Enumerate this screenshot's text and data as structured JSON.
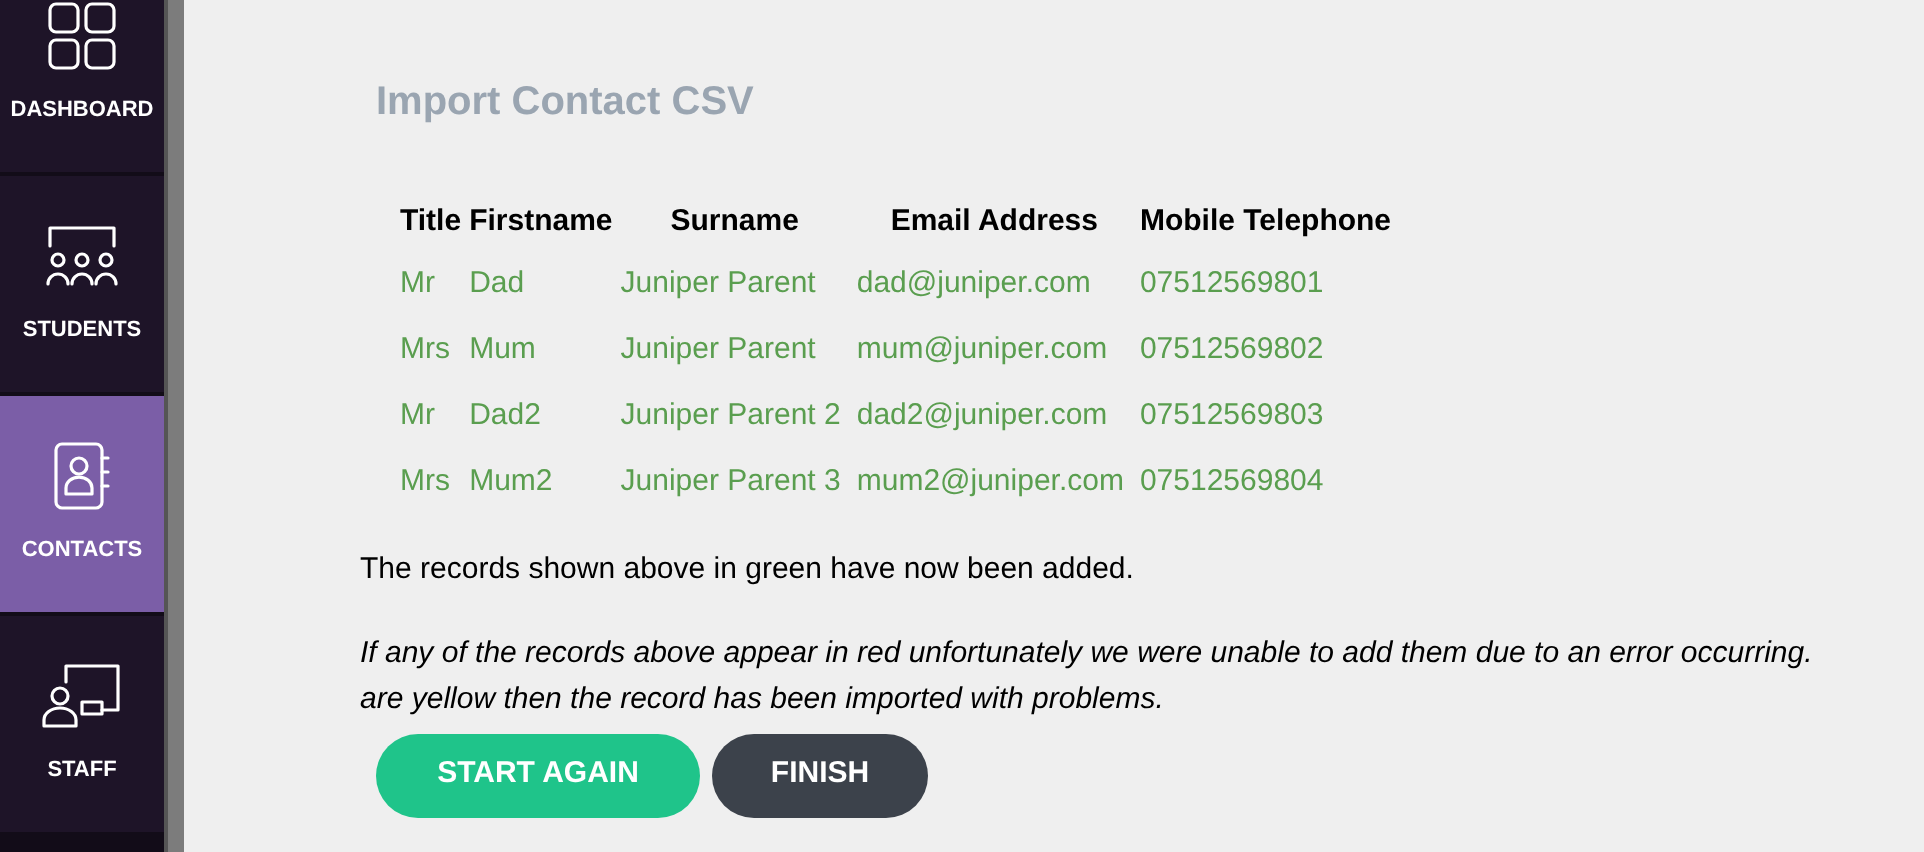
{
  "sidebar": {
    "items": [
      {
        "label": "DASHBOARD",
        "kind": "grid",
        "selected": false
      },
      {
        "label": "STUDENTS",
        "kind": "students",
        "selected": false
      },
      {
        "label": "CONTACTS",
        "kind": "contacts",
        "selected": true
      },
      {
        "label": "STAFF",
        "kind": "staff",
        "selected": false
      }
    ]
  },
  "page_title": "Import Contact CSV",
  "table": {
    "columns": [
      "Title",
      "Firstname",
      "Surname",
      "Email Address",
      "Mobile Telephone"
    ],
    "rows": [
      {
        "color": "#5a9e4f",
        "cells": [
          "Mr",
          "Dad",
          "Juniper Parent",
          "dad@juniper.com",
          "07512569801"
        ]
      },
      {
        "color": "#5a9e4f",
        "cells": [
          "Mrs",
          "Mum",
          "Juniper Parent",
          "mum@juniper.com",
          "07512569802"
        ]
      },
      {
        "color": "#5a9e4f",
        "cells": [
          "Mr",
          "Dad2",
          "Juniper Parent 2",
          "dad2@juniper.com",
          "07512569803"
        ]
      },
      {
        "color": "#5a9e4f",
        "cells": [
          "Mrs",
          "Mum2",
          "Juniper Parent 3",
          "mum2@juniper.com",
          "07512569804"
        ]
      }
    ]
  },
  "message": "The records shown above in green have now been added.",
  "note_lines": [
    "If any of the records above appear in red unfortunately we were unable to add them due to an error occurring.",
    "are yellow then the record has been imported with problems."
  ],
  "buttons": [
    {
      "label": "START AGAIN",
      "kind": "primary"
    },
    {
      "label": "FINISH",
      "kind": "secondary"
    }
  ]
}
